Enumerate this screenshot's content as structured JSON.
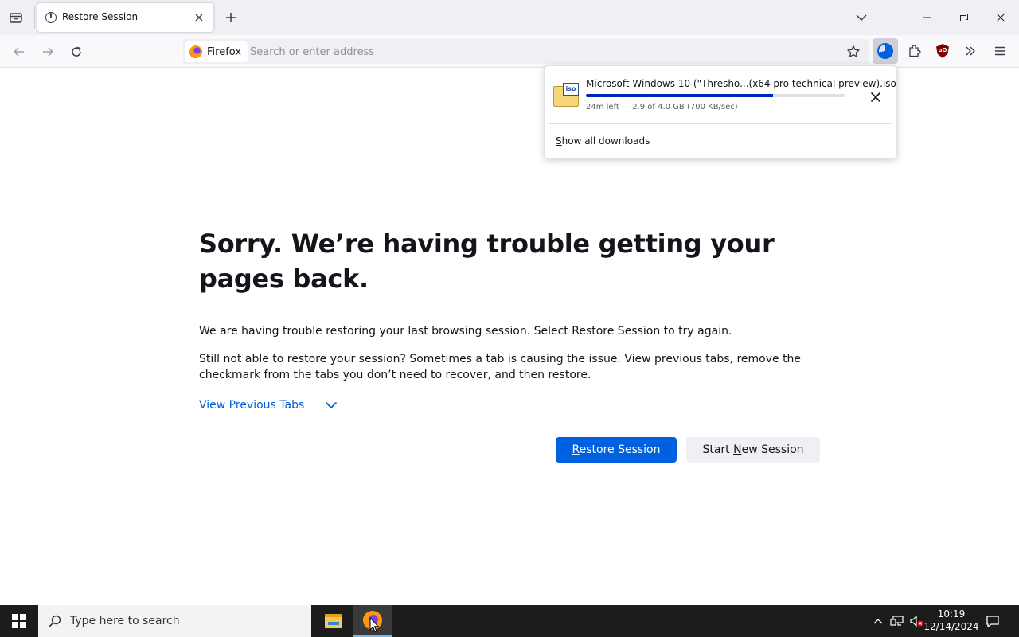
{
  "browser": {
    "tab": {
      "title": "Restore Session",
      "icon": "info-icon"
    },
    "urlbar": {
      "identity_label": "Firefox",
      "placeholder": "Search or enter address"
    }
  },
  "downloads_panel": {
    "file_name": "Microsoft Windows 10 (\"Thresho...(x64 pro technical preview).iso",
    "file_icon_label": "iso",
    "progress_fraction": 0.72,
    "status": "24m left — 2.9 of 4.0 GB (700 KB/sec)",
    "show_all_label": "Show all downloads"
  },
  "page": {
    "heading": "Sorry. We’re having trouble getting your pages back.",
    "message_1": "We are having trouble restoring your last browsing session. Select Restore Session to try again.",
    "message_2": "Still not able to restore your session? Sometimes a tab is causing the issue. View previous tabs, remove the checkmark from the tabs you don’t need to recover, and then restore.",
    "view_previous_tabs": "View Previous Tabs",
    "restore_button": {
      "accesskey": "R",
      "rest": "estore Session"
    },
    "new_session_button": {
      "before": "Start ",
      "accesskey": "N",
      "after": "ew Session"
    }
  },
  "taskbar": {
    "search_placeholder": "Type here to search",
    "time": "10:19",
    "date": "12/14/2024"
  },
  "colors": {
    "accent": "#0061e0",
    "progress": "#0022c8",
    "taskbar": "#1c1c1c"
  }
}
